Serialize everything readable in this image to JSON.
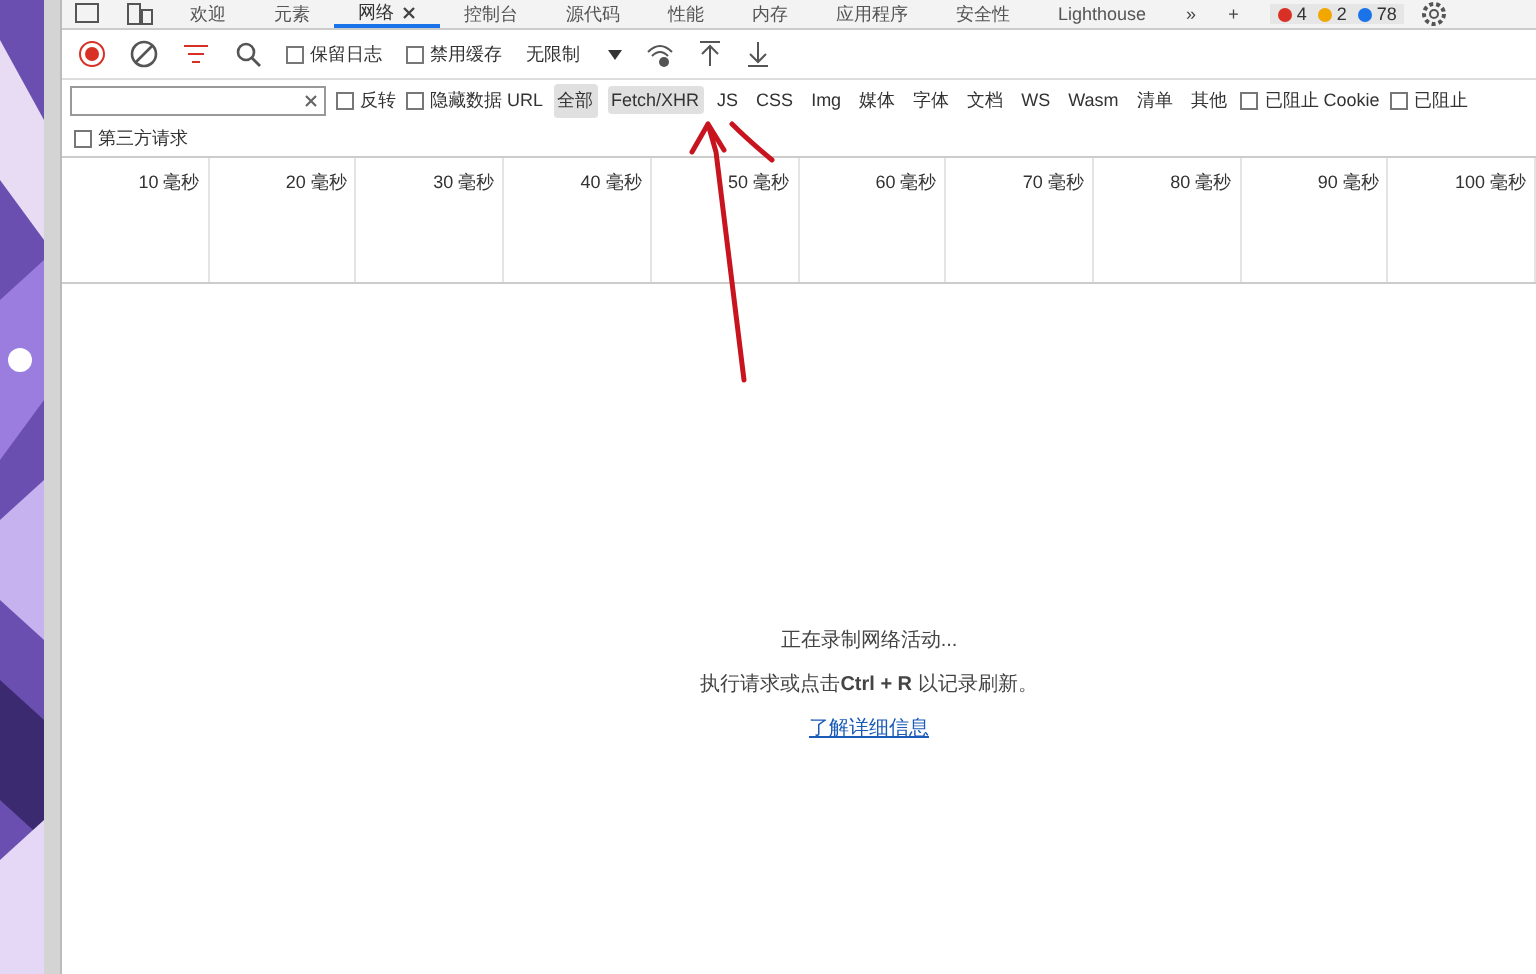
{
  "tabs": [
    {
      "label": "欢迎",
      "selected": false,
      "closable": false
    },
    {
      "label": "元素",
      "selected": false,
      "closable": false
    },
    {
      "label": "网络",
      "selected": true,
      "closable": true
    },
    {
      "label": "控制台",
      "selected": false,
      "closable": false
    },
    {
      "label": "源代码",
      "selected": false,
      "closable": false
    },
    {
      "label": "性能",
      "selected": false,
      "closable": false
    },
    {
      "label": "内存",
      "selected": false,
      "closable": false
    },
    {
      "label": "应用程序",
      "selected": false,
      "closable": false
    },
    {
      "label": "安全性",
      "selected": false,
      "closable": false
    },
    {
      "label": "Lighthouse",
      "selected": false,
      "closable": false
    }
  ],
  "tab_more": "»",
  "tab_add": "+",
  "badges": [
    {
      "count": "4",
      "color": "#d93025"
    },
    {
      "count": "2",
      "color": "#f2a600"
    },
    {
      "count": "78",
      "color": "#1a73e8"
    }
  ],
  "toolbar": {
    "recording": true,
    "preserve_log": {
      "label": "保留日志",
      "checked": false
    },
    "disable_cache": {
      "label": "禁用缓存",
      "checked": false
    },
    "throttle": "无限制"
  },
  "filter": {
    "invert": {
      "label": "反转",
      "checked": false
    },
    "hide_data_urls": {
      "label": "隐藏数据 URL",
      "checked": false
    },
    "types": [
      {
        "label": "全部",
        "selected": true
      },
      {
        "label": "Fetch/XHR",
        "selected": true
      },
      {
        "label": "JS",
        "selected": false
      },
      {
        "label": "CSS",
        "selected": false
      },
      {
        "label": "Img",
        "selected": false
      },
      {
        "label": "媒体",
        "selected": false
      },
      {
        "label": "字体",
        "selected": false
      },
      {
        "label": "文档",
        "selected": false
      },
      {
        "label": "WS",
        "selected": false
      },
      {
        "label": "Wasm",
        "selected": false
      },
      {
        "label": "清单",
        "selected": false
      },
      {
        "label": "其他",
        "selected": false
      }
    ],
    "blocked_cookies": {
      "label": "已阻止 Cookie",
      "checked": false
    },
    "blocked_requests": {
      "label": "已阻止",
      "checked": false
    },
    "third_party": {
      "label": "第三方请求",
      "checked": false
    }
  },
  "timeline": [
    "10 毫秒",
    "20 毫秒",
    "30 毫秒",
    "40 毫秒",
    "50 毫秒",
    "60 毫秒",
    "70 毫秒",
    "80 毫秒",
    "90 毫秒",
    "100 毫秒"
  ],
  "empty": {
    "line_1": "正在录制网络活动...",
    "line_2": "执行请求或点击**Ctrl + R** 以记录刷新。",
    "link": "了解详细信息"
  }
}
